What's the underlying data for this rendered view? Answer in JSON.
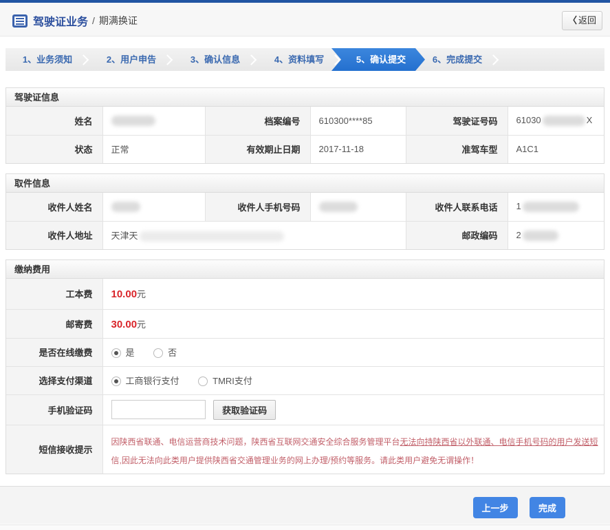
{
  "page": {
    "title_primary": "驾驶证业务",
    "title_separator": "/",
    "title_secondary": "期满换证",
    "back_arrow": "〈",
    "back_label": "返回"
  },
  "steps": [
    {
      "label": "1、业务须知"
    },
    {
      "label": "2、用户申告"
    },
    {
      "label": "3、确认信息"
    },
    {
      "label": "4、资料填写"
    },
    {
      "label": "5、确认提交"
    },
    {
      "label": "6、完成提交"
    }
  ],
  "license_section": {
    "title": "驾驶证信息",
    "name_label": "姓名",
    "file_no_label": "档案编号",
    "file_no_value": "610300****85",
    "license_no_label": "驾驶证号码",
    "license_no_prefix": "61030",
    "license_no_suffix": "X",
    "status_label": "状态",
    "status_value": "正常",
    "expiry_label": "有效期止日期",
    "expiry_value": "2017-11-18",
    "vehicle_class_label": "准驾车型",
    "vehicle_class_value": "A1C1"
  },
  "pickup_section": {
    "title": "取件信息",
    "recipient_name_label": "收件人姓名",
    "recipient_mobile_label": "收件人手机号码",
    "recipient_phone_label": "收件人联系电话",
    "recipient_phone_prefix": "1",
    "recipient_address_label": "收件人地址",
    "recipient_address_prefix": "天津天",
    "postcode_label": "邮政编码",
    "postcode_prefix": "2"
  },
  "fees_section": {
    "title": "缴纳费用",
    "cost_label": "工本费",
    "cost_value": "10.00",
    "cost_unit": "元",
    "postage_label": "邮寄费",
    "postage_value": "30.00",
    "postage_unit": "元",
    "online_pay_label": "是否在线缴费",
    "online_pay_yes": "是",
    "online_pay_no": "否",
    "channel_label": "选择支付渠道",
    "channel_icbc": "工商银行支付",
    "channel_tmri": "TMRI支付",
    "sms_code_label": "手机验证码",
    "sms_code_button": "获取验证码",
    "sms_notice_label": "短信接收提示",
    "sms_notice_part1": "因陕西省联通、电信运营商技术问题，陕西省互联网交通安全综合服务管理平台",
    "sms_notice_underline": "无法向持陕西省以外联通、电信手机号码的用户发送短",
    "sms_notice_part2": "信,因此无法向此类用户提供陕西省交通管理业务的网上办理/预约等服务。请此类用户避免无谓操作！"
  },
  "footer": {
    "prev_button": "上一步",
    "finish_button": "完成"
  }
}
